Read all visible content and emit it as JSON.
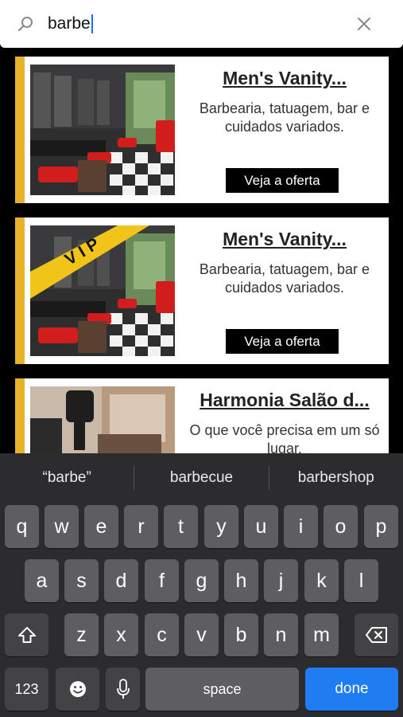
{
  "search": {
    "query": "barbe"
  },
  "results": [
    {
      "title": "Men's Vanity...",
      "description": "Barbearia, tatuagem, bar e cuidados variados.",
      "button": "Veja a oferta",
      "vip": false
    },
    {
      "title": "Men's Vanity...",
      "description": "Barbearia, tatuagem, bar e cuidados variados.",
      "button": "Veja a oferta",
      "vip": true,
      "badge": "VIP"
    },
    {
      "title": "Harmonia Salão d...",
      "description": "O que você precisa em um só lugar."
    }
  ],
  "keyboard": {
    "suggestions": [
      "“barbe”",
      "barbecue",
      "barbershop"
    ],
    "row1": [
      "q",
      "w",
      "e",
      "r",
      "t",
      "y",
      "u",
      "i",
      "o",
      "p"
    ],
    "row2": [
      "a",
      "s",
      "d",
      "f",
      "g",
      "h",
      "j",
      "k",
      "l"
    ],
    "row3": [
      "z",
      "x",
      "c",
      "v",
      "b",
      "n",
      "m"
    ],
    "numbers_label": "123",
    "space_label": "space",
    "done_label": "done"
  },
  "colors": {
    "accent": "#e8b32a",
    "done": "#1f7cf2"
  }
}
